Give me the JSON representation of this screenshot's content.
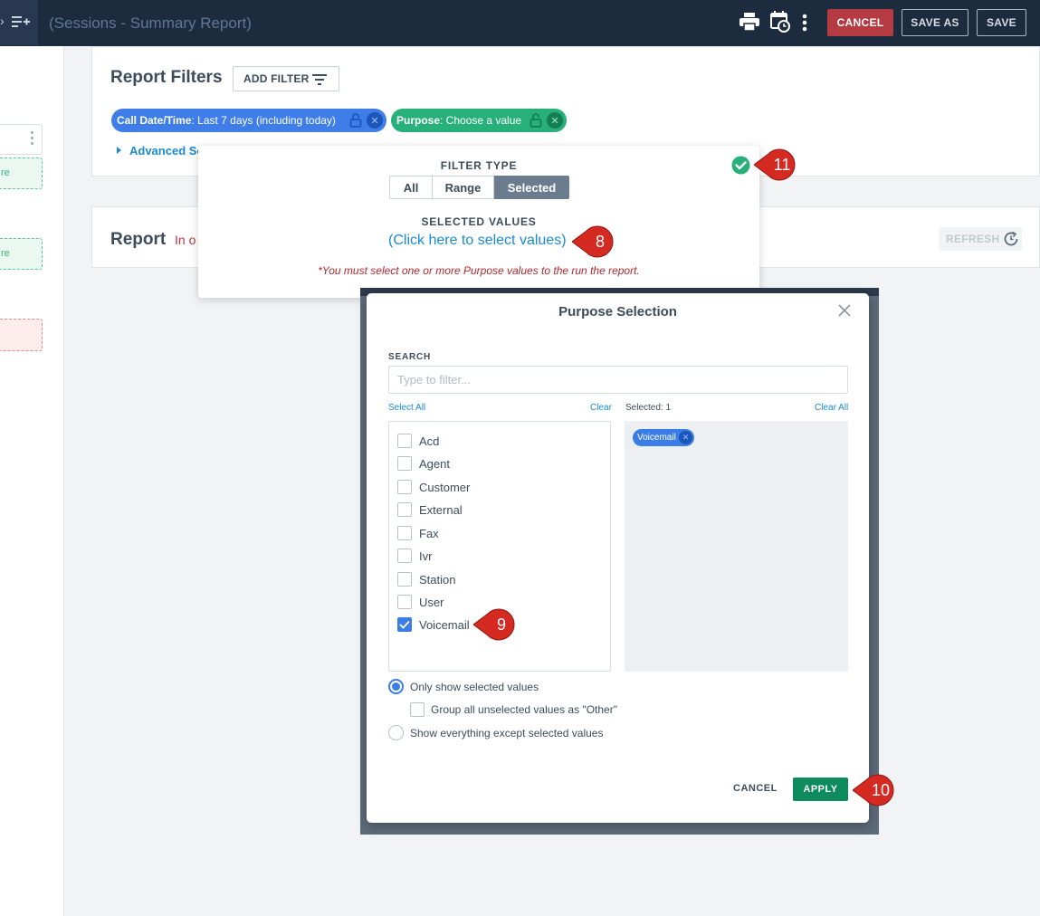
{
  "topbar": {
    "title": "(Sessions - Summary Report)",
    "cancel_label": "CANCEL",
    "save_as_label": "SAVE AS",
    "save_label": "SAVE"
  },
  "left_panel": {
    "green_box_text": "re",
    "green_box2_text": "re"
  },
  "filters": {
    "title": "Report Filters",
    "add_filter_label": "ADD FILTER",
    "chips": [
      {
        "field": "Call Date/Time",
        "value": ": Last 7 days (including today)"
      },
      {
        "field": "Purpose",
        "value": ": Choose a value"
      }
    ],
    "advanced_label": "Advanced So"
  },
  "report": {
    "title": "Report",
    "subtitle": "In o",
    "refresh_label": "REFRESH"
  },
  "filter_popover": {
    "filter_type_label": "FILTER TYPE",
    "types": [
      "All",
      "Range",
      "Selected"
    ],
    "selected_type": "Selected",
    "selected_values_label": "SELECTED VALUES",
    "select_link": "(Click here to select values)",
    "warning": "*You must select one or more Purpose values to the run the report."
  },
  "modal": {
    "title": "Purpose Selection",
    "search_label": "SEARCH",
    "search_placeholder": "Type to filter...",
    "select_all": "Select All",
    "clear": "Clear",
    "selected_count": "Selected: 1",
    "clear_all": "Clear All",
    "options": [
      {
        "label": "Acd",
        "checked": false
      },
      {
        "label": "Agent",
        "checked": false
      },
      {
        "label": "Customer",
        "checked": false
      },
      {
        "label": "External",
        "checked": false
      },
      {
        "label": "Fax",
        "checked": false
      },
      {
        "label": "Ivr",
        "checked": false
      },
      {
        "label": "Station",
        "checked": false
      },
      {
        "label": "User",
        "checked": false
      },
      {
        "label": "Voicemail",
        "checked": true
      }
    ],
    "selected_chips": [
      "Voicemail"
    ],
    "only_show_selected": "Only show selected values",
    "group_unselected": "Group all unselected values as \"Other\"",
    "show_except": "Show everything except selected values",
    "cancel_label": "CANCEL",
    "apply_label": "APPLY"
  },
  "callouts": [
    "8",
    "9",
    "10",
    "11"
  ],
  "colors": {
    "topbar": "#1d2b3e",
    "cancel_red": "#b63a42",
    "chip_blue": "#3f7de8",
    "chip_green": "#27b07a",
    "apply_green": "#0e8a5f",
    "link_blue": "#1a8ad1",
    "callout_red": "#d42a22"
  }
}
